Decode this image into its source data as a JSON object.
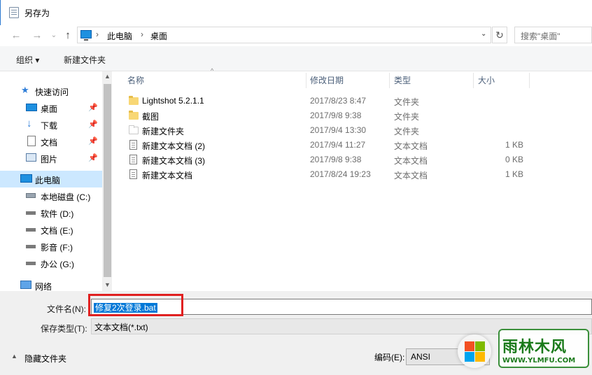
{
  "window": {
    "title": "另存为"
  },
  "address": {
    "crumbs": [
      "此电脑",
      "桌面"
    ],
    "search_placeholder": "搜索\"桌面\""
  },
  "toolbar": {
    "organize": "组织 ▾",
    "new_folder": "新建文件夹"
  },
  "sidebar": {
    "items": [
      {
        "label": "快速访问",
        "icon": "star-icon"
      },
      {
        "label": "桌面",
        "icon": "desktop-icon",
        "pinned": true
      },
      {
        "label": "下载",
        "icon": "download-icon",
        "pinned": true
      },
      {
        "label": "文档",
        "icon": "documents-icon",
        "pinned": true
      },
      {
        "label": "图片",
        "icon": "pictures-icon",
        "pinned": true
      },
      {
        "label": "此电脑",
        "icon": "computer-icon",
        "selected": true
      },
      {
        "label": "本地磁盘 (C:)",
        "icon": "drive-icon"
      },
      {
        "label": "软件 (D:)",
        "icon": "drive-icon"
      },
      {
        "label": "文档 (E:)",
        "icon": "drive-icon"
      },
      {
        "label": "影音 (F:)",
        "icon": "drive-icon"
      },
      {
        "label": "办公 (G:)",
        "icon": "drive-icon"
      },
      {
        "label": "网络",
        "icon": "network-icon"
      }
    ]
  },
  "columns": [
    "名称",
    "修改日期",
    "类型",
    "大小"
  ],
  "files": [
    {
      "name": "Lightshot 5.2.1.1",
      "date": "2017/8/23 8:47",
      "type": "文件夹",
      "size": "",
      "icon": "folder-icon"
    },
    {
      "name": "截图",
      "date": "2017/9/8 9:38",
      "type": "文件夹",
      "size": "",
      "icon": "folder-icon"
    },
    {
      "name": "新建文件夹",
      "date": "2017/9/4 13:30",
      "type": "文件夹",
      "size": "",
      "icon": "empty-folder-icon"
    },
    {
      "name": "新建文本文档 (2)",
      "date": "2017/9/4 11:27",
      "type": "文本文档",
      "size": "1 KB",
      "icon": "text-file-icon"
    },
    {
      "name": "新建文本文档 (3)",
      "date": "2017/9/8 9:38",
      "type": "文本文档",
      "size": "0 KB",
      "icon": "text-file-icon"
    },
    {
      "name": "新建文本文档",
      "date": "2017/8/24 19:23",
      "type": "文本文档",
      "size": "1 KB",
      "icon": "text-file-icon"
    }
  ],
  "form": {
    "filename_label": "文件名(N):",
    "filename_value": "修复2次登录.bat",
    "filetype_label": "保存类型(T):",
    "filetype_value": "文本文档(*.txt)",
    "encoding_label": "编码(E):",
    "encoding_value": "ANSI",
    "hide_folders": "隐藏文件夹"
  },
  "watermark": {
    "title": "雨林木风",
    "url": "WWW.YLMFU.COM"
  }
}
